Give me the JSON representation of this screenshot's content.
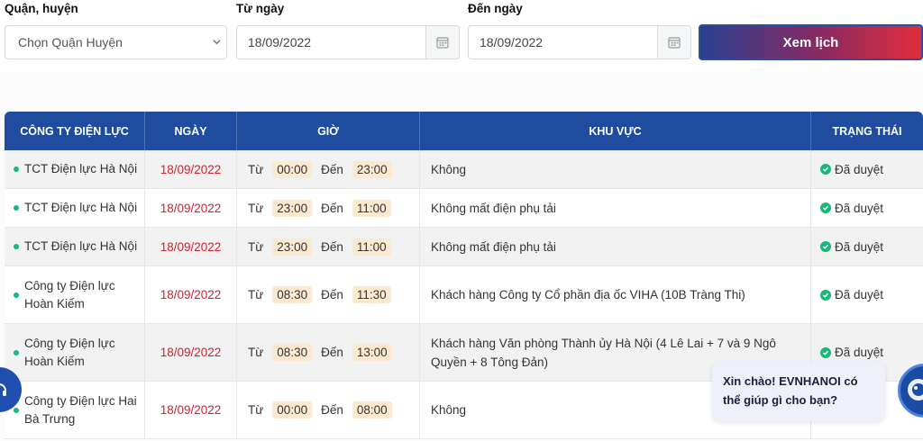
{
  "filters": {
    "district_label": "Quận, huyện",
    "district_value": "Chọn Quận Huyện",
    "from_label": "Từ ngày",
    "from_value": "18/09/2022",
    "to_label": "Đến ngày",
    "to_value": "18/09/2022",
    "submit_label": "Xem lịch"
  },
  "table": {
    "headers": [
      "CÔNG TY ĐIỆN LỰC",
      "NGÀY",
      "GIỜ",
      "KHU VỰC",
      "TRẠNG THÁI"
    ],
    "from_word": "Từ",
    "to_word": "Đến",
    "rows": [
      {
        "company": "TCT Điện lực Hà Nội",
        "date": "18/09/2022",
        "start": "00:00",
        "end": "23:00",
        "area": "Không",
        "status": "Đã duyệt"
      },
      {
        "company": "TCT Điện lực Hà Nội",
        "date": "18/09/2022",
        "start": "23:00",
        "end": "11:00",
        "area": "Không mất điện phụ tải",
        "status": "Đã duyệt"
      },
      {
        "company": "TCT Điện lực Hà Nội",
        "date": "18/09/2022",
        "start": "23:00",
        "end": "11:00",
        "area": "Không mất điện phụ tải",
        "status": "Đã duyệt"
      },
      {
        "company": "Công ty Điện lực Hoàn Kiếm",
        "date": "18/09/2022",
        "start": "08:30",
        "end": "11:30",
        "area": "Khách hàng Công ty Cổ phần địa ốc VIHA (10B Tràng Thi)",
        "status": "Đã duyệt"
      },
      {
        "company": "Công ty Điện lực Hoàn Kiếm",
        "date": "18/09/2022",
        "start": "08:30",
        "end": "13:00",
        "area": "Khách hàng Văn phòng Thành ủy Hà Nội (4 Lê Lai + 7 và 9 Ngô Quyền + 8 Tông Đản)",
        "status": "Đã duyệt"
      },
      {
        "company": "Công ty Điện lực Hai Bà Trưng",
        "date": "18/09/2022",
        "start": "00:00",
        "end": "08:00",
        "area": "Không",
        "status": ""
      }
    ]
  },
  "chat": {
    "greeting": "Xin chào! EVNHANOI có thể giúp gì cho bạn?"
  },
  "colors": {
    "header_bg": "#1f4c9e",
    "date_red": "#d0202f",
    "status_green": "#19b87a",
    "time_pill": "#fce9cf"
  },
  "icons": [
    "chevron-down-icon",
    "calendar-icon",
    "check-circle-icon",
    "chatbot-avatar-icon",
    "support-icon"
  ]
}
